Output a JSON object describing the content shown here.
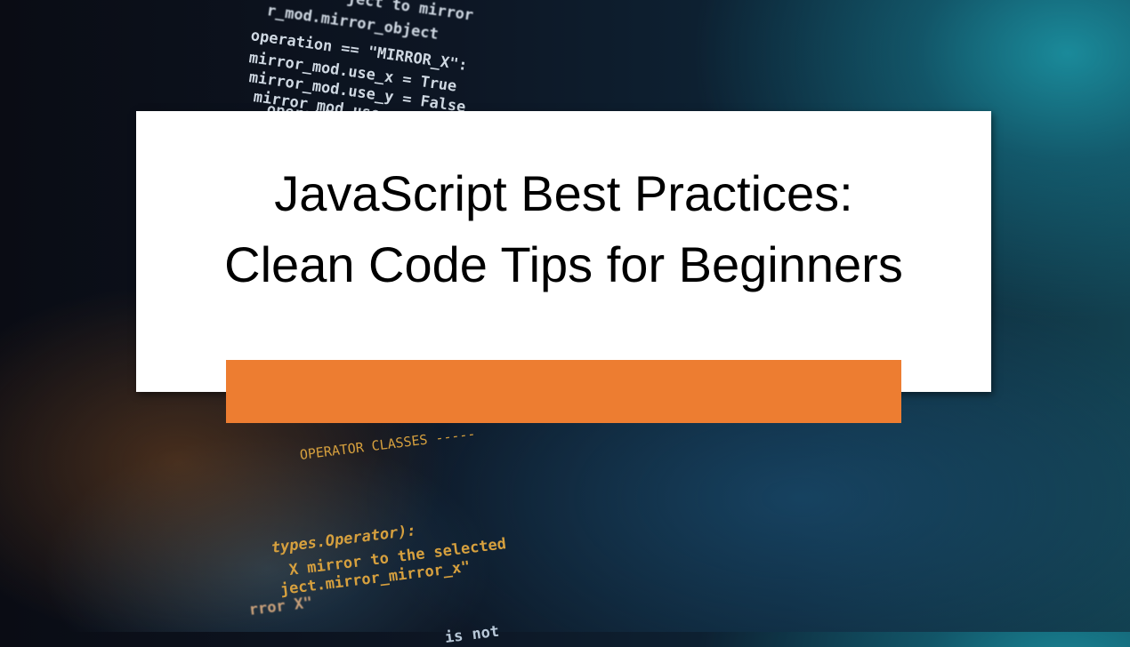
{
  "background_code": {
    "top_lines": [
      "ject to mirror",
      "r_mod.mirror_object",
      "operation == \"MIRROR_X\":",
      "mirror_mod.use_x = True",
      "mirror_mod.use_y = False",
      "mirror_mod.use_z = False",
      "operation"
    ],
    "bottom_lines": [
      "OPERATOR CLASSES -----",
      "types.Operator):",
      "X mirror to the selected",
      "ject.mirror_mirror_x\"",
      "rror X\"",
      "is not"
    ]
  },
  "slide": {
    "title_line1": "JavaScript Best Practices:",
    "title_line2": "Clean Code Tips for Beginners",
    "accent_color": "#ED7D31"
  }
}
